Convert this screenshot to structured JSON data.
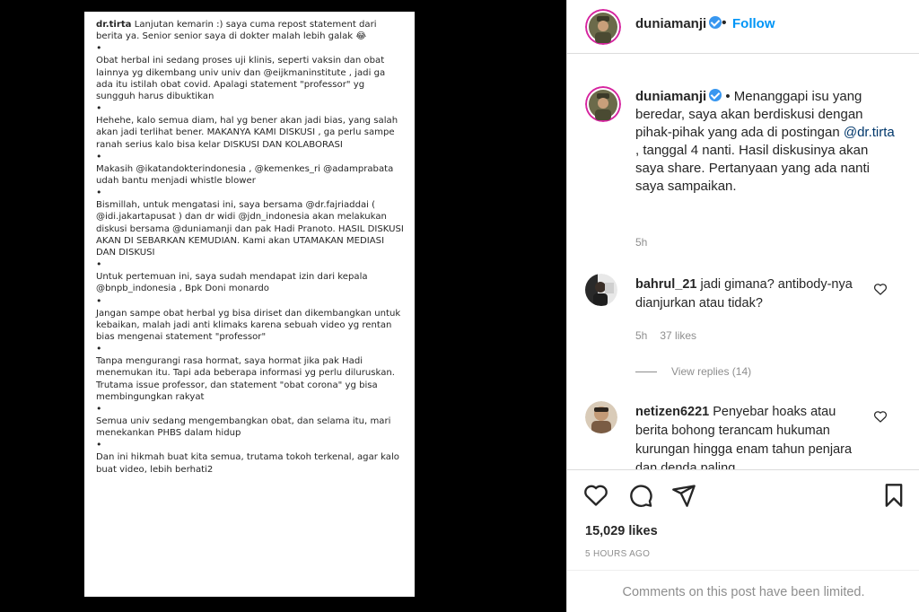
{
  "repost": {
    "username": "dr.tirta",
    "paragraphs": [
      "Lanjutan kemarin :) saya cuma repost statement dari berita ya. Senior senior saya di dokter malah lebih galak 😂",
      "Obat herbal ini sedang proses uji klinis, seperti vaksin dan obat lainnya yg dikembang univ univ dan @eijkmaninstitute , jadi ga ada itu istilah obat covid. Apalagi statement \"professor\" yg sungguh harus dibuktikan",
      "Hehehe, kalo semua diam, hal yg bener akan jadi bias, yang salah akan jadi terlihat bener. MAKANYA KAMI DISKUSI , ga perlu sampe ranah serius kalo bisa kelar DISKUSI DAN KOLABORASI",
      "Makasih @ikatandokterindonesia ,  @kemenkes_ri @adamprabata udah bantu menjadi whistle blower",
      "Bismillah, untuk mengatasi ini, saya bersama @dr.fajriaddai ( @idi.jakartapusat ) dan dr widi  @jdn_indonesia akan melakukan diskusi bersama @duniamanji dan pak Hadi Pranoto. HASIL DISKUSI AKAN DI SEBARKAN KEMUDIAN. Kami akan UTAMAKAN MEDIASI DAN DISKUSI",
      "Untuk pertemuan ini, saya sudah mendapat izin dari kepala @bnpb_indonesia , Bpk Doni monardo",
      "Jangan sampe obat herbal yg bisa diriset dan dikembangkan untuk kebaikan, malah jadi anti klimaks karena sebuah video yg rentan bias mengenai statement \"professor\"",
      "Tanpa mengurangi rasa hormat, saya hormat jika pak Hadi menemukan itu. Tapi ada beberapa informasi yg perlu diluruskan. Trutama issue professor, dan statement \"obat corona\" yg bisa membingungkan rakyat",
      "Semua univ sedang mengembangkan obat, dan selama itu, mari menekankan PHBS dalam hidup",
      "Dan ini hikmah buat kita semua, trutama tokoh terkenal, agar kalo buat video, lebih berhati2"
    ],
    "bullet": "•"
  },
  "header": {
    "username": "duniamanji",
    "separator": "•",
    "follow_label": "Follow"
  },
  "caption": {
    "username": "duniamanji",
    "text_before": "• Menanggapi isu yang beredar, saya akan berdiskusi dengan pihak-pihak yang ada di postingan ",
    "mention": "@dr.tirta",
    "text_after": " , tanggal 4 nanti. Hasil diskusinya akan saya share. Pertanyaan yang ada nanti saya sampaikan.",
    "time": "5h"
  },
  "comments": [
    {
      "username": "bahrul_21",
      "text": "jadi gimana? antibody-nya dianjurkan atau tidak?",
      "time": "5h",
      "likes": "37 likes",
      "view_replies": "View replies (14)"
    },
    {
      "username": "netizen6221",
      "text": "Penyebar hoaks atau berita bohong terancam hukuman kurungan hingga enam tahun penjara dan denda paling"
    }
  ],
  "actions": {
    "likes": "15,029 likes",
    "time_ago": "5 HOURS AGO",
    "limited_notice": "Comments on this post have been limited."
  },
  "colors": {
    "link_blue": "#0095f6",
    "mention_blue": "#00376b",
    "muted": "#8e8e8e",
    "verified": "#3897f0"
  }
}
